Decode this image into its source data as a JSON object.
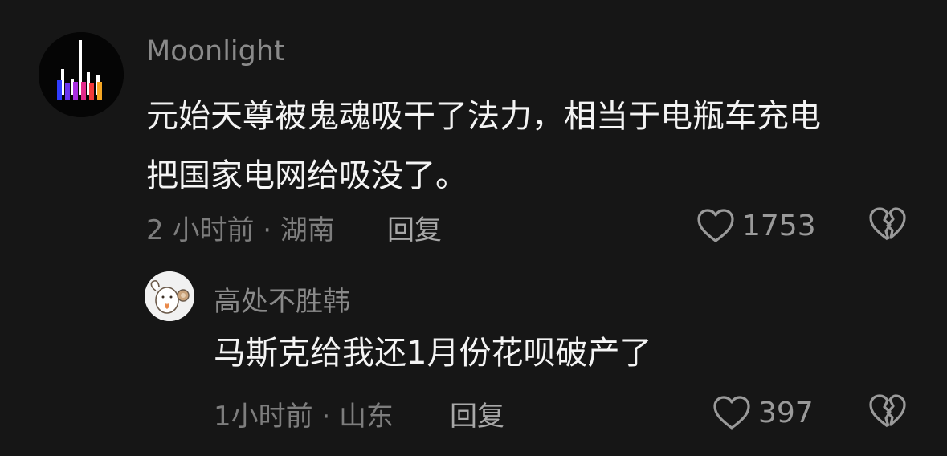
{
  "comments": [
    {
      "username": "Moonlight",
      "text": "元始天尊被鬼魂吸干了法力，相当于电瓶车充电\n把国家电网给吸没了。",
      "time": "2 小时前",
      "separator": "·",
      "location": "湖南",
      "meta": "2 小时前 · 湖南",
      "reply_label": "回复",
      "likes": "1753",
      "avatar_icon": "equalizer-bars-icon",
      "avatar_colors": [
        "#2f3cff",
        "#8b2cf2",
        "#f02c6f",
        "#f0402a",
        "#f5a623"
      ]
    },
    {
      "username": "高处不胜韩",
      "text": "马斯克给我还1月份花呗破产了",
      "time": "1小时前",
      "separator": "·",
      "location": "山东",
      "meta": "1小时前 · 山东",
      "reply_label": "回复",
      "likes": "397",
      "avatar_icon": "cartoon-animal-icon"
    }
  ],
  "icons": {
    "like": "heart-outline-icon",
    "dislike": "broken-heart-icon"
  },
  "colors": {
    "background": "#161616",
    "text": "#f4f4f4",
    "secondary_text": "#8a8a8a",
    "icon": "#9a9a9a"
  }
}
